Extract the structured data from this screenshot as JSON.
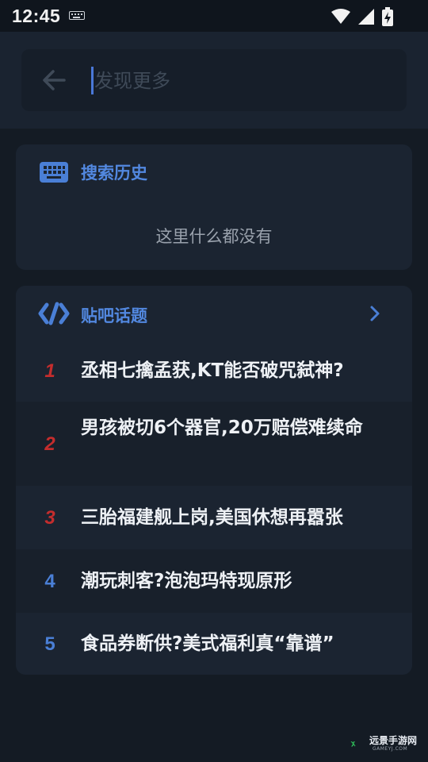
{
  "status_bar": {
    "time": "12:45"
  },
  "search": {
    "placeholder": "发现更多",
    "value": ""
  },
  "history": {
    "title": "搜索历史",
    "empty_text": "这里什么都没有"
  },
  "topics": {
    "title": "贴吧话题",
    "items": [
      {
        "rank": "1",
        "text": "丞相七擒孟获,KT能否破咒弑神?"
      },
      {
        "rank": "2",
        "text": "男孩被切6个器官,20万赔偿难续命"
      },
      {
        "rank": "3",
        "text": "三胎福建舰上岗,美国休想再嚣张"
      },
      {
        "rank": "4",
        "text": "潮玩刺客?泡泡玛特现原形"
      },
      {
        "rank": "5",
        "text": "食品券断供?美式福利真“靠谱”"
      }
    ]
  },
  "watermark": {
    "name": "远景手游网",
    "url": "GAMEYJ.COM"
  },
  "colors": {
    "accent": "#5288e0",
    "hot_rank": "#c42d2d",
    "background": "#141b24"
  }
}
